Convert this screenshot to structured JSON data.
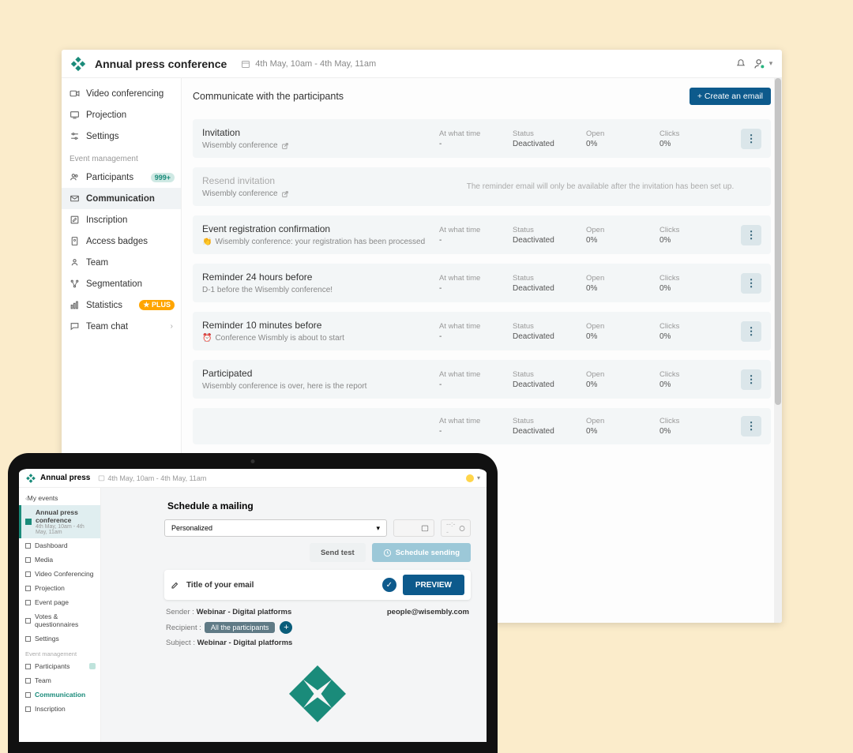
{
  "header": {
    "title": "Annual press conference",
    "date_range": "4th May, 10am - 4th May, 11am"
  },
  "sidebar": {
    "items_top": [
      {
        "label": "Video conferencing"
      },
      {
        "label": "Projection"
      },
      {
        "label": "Settings"
      }
    ],
    "section": "Event management",
    "items_mgmt": [
      {
        "label": "Participants",
        "badge": "999+"
      },
      {
        "label": "Communication"
      },
      {
        "label": "Inscription"
      },
      {
        "label": "Access badges"
      },
      {
        "label": "Team"
      },
      {
        "label": "Segmentation"
      },
      {
        "label": "Statistics",
        "badge_orange": "★ PLUS"
      },
      {
        "label": "Team chat",
        "chevron": true
      }
    ]
  },
  "content": {
    "heading": "Communicate with the participants",
    "create_btn": "+ Create an email",
    "cols": {
      "time": "At what time",
      "status": "Status",
      "open": "Open",
      "clicks": "Clicks"
    },
    "deactivated": "Deactivated",
    "zero": "0%",
    "dash": "-",
    "resend_note": "The reminder email will only be available after the invitation has been set up.",
    "cards": [
      {
        "title": "Invitation",
        "sub": "Wisembly conference",
        "ext": true
      },
      {
        "title": "Resend invitation",
        "sub": "Wisembly conference",
        "ext": true,
        "muted": true,
        "note": true
      },
      {
        "title": "Event registration confirmation",
        "sub": "Wisembly conference: your registration has been processed",
        "emoji": "👏"
      },
      {
        "title": "Reminder 24 hours before",
        "sub": "D-1 before the Wisembly conference!"
      },
      {
        "title": "Reminder 10 minutes before",
        "sub": "Conference Wismbly is about to start",
        "emoji": "⏰"
      },
      {
        "title": "Participated",
        "sub": "Wisembly conference is over, here is the report"
      },
      {
        "title": "",
        "sub": ""
      }
    ]
  },
  "laptop": {
    "header_title": "Annual press",
    "header_date": "4th May, 10am - 4th May, 11am",
    "side": {
      "my_events": "My events",
      "event_title": "Annual press conference",
      "event_sub": "4th May, 10am - 4th May, 11am",
      "items": [
        "Dashboard",
        "Media",
        "Video Conferencing",
        "Projection",
        "Event page",
        "Votes & questionnaires",
        "Settings"
      ],
      "section": "Event management",
      "mgmt": [
        {
          "label": "Participants",
          "badge": true
        },
        {
          "label": "Team"
        },
        {
          "label": "Communication",
          "teal": true
        },
        {
          "label": "Inscription"
        }
      ]
    },
    "sched": {
      "title": "Schedule a mailing",
      "pick": "Personalized",
      "btn_test": "Send test",
      "btn_sched": "Schedule sending",
      "email_title": "Title of your email",
      "preview": "PREVIEW",
      "sender_label": "Sender :",
      "sender_val": "Webinar - Digital platforms",
      "sender_email": "people@wisembly.com",
      "recipient_label": "Recipient :",
      "recipient_pill": "All the participants",
      "subject_label": "Subject :",
      "subject_val": "Webinar - Digital platforms"
    }
  }
}
